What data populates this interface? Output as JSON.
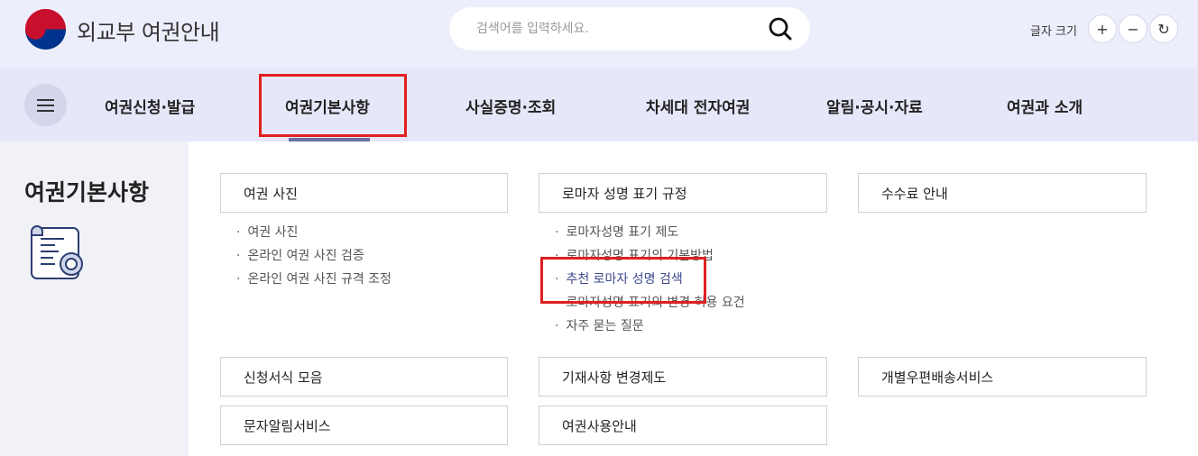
{
  "header": {
    "site_title": "외교부 여권안내",
    "search": {
      "placeholder": "검색어를 입력하세요."
    },
    "font_size": {
      "label": "글자 크기",
      "increase": "+",
      "decrease": "−",
      "reset": "↻"
    }
  },
  "nav": {
    "items": [
      {
        "label": "여권신청·발급"
      },
      {
        "label": "여권기본사항"
      },
      {
        "label": "사실증명·조회"
      },
      {
        "label": "차세대 전자여권"
      },
      {
        "label": "알림·공시·자료"
      },
      {
        "label": "여권과 소개"
      }
    ]
  },
  "sidebar": {
    "title": "여권기본사항"
  },
  "content": {
    "sections": [
      {
        "title": "여권 사진",
        "items": [
          "여권 사진",
          "온라인 여권 사진 검증",
          "온라인 여권 사진 규격 조정"
        ]
      },
      {
        "title": "로마자 성명 표기 규정",
        "items": [
          "로마자성명 표기 제도",
          "로마자성명 표기의 기본방법",
          "추천 로마자 성명 검색",
          "로마자성명 표기의 변경 허용 요건",
          "자주 묻는 질문"
        ]
      },
      {
        "title": "수수료 안내",
        "items": []
      },
      {
        "title": "신청서식 모음",
        "items": []
      },
      {
        "title": "기재사항 변경제도",
        "items": []
      },
      {
        "title": "개별우편배송서비스",
        "items": []
      },
      {
        "title": "문자알림서비스",
        "items": []
      },
      {
        "title": "여권사용안내",
        "items": []
      }
    ]
  },
  "colors": {
    "header_bg": "#edeefb",
    "nav_bg": "#e6e7f9",
    "active_link": "#3d4a8c",
    "annotation_red": "#e02020"
  }
}
